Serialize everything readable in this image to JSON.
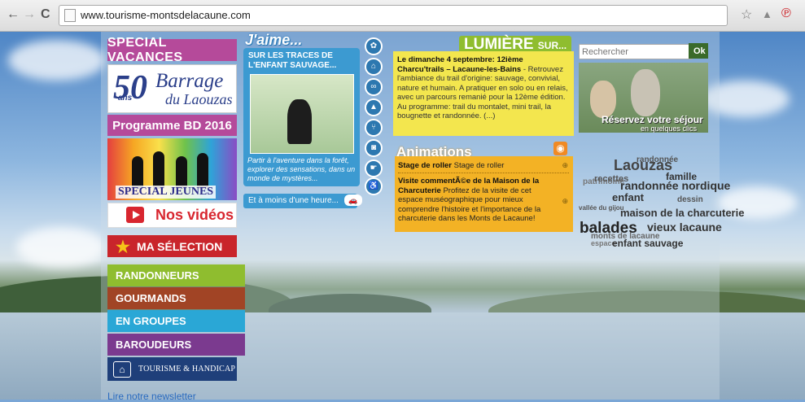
{
  "browser": {
    "url": "www.tourisme-montsdelacaune.com",
    "back_icon": "←",
    "forward_icon": "→",
    "reload_icon": "C",
    "star_icon": "☆",
    "ext_icon": "▲",
    "pin_icon": "℗"
  },
  "left_menu": {
    "special_vacances": "SPECIAL VACANCES",
    "barrage": {
      "num": "50",
      "ans": "ans",
      "line1": "Barrage",
      "line2": "du Laouzas"
    },
    "programme_bd": "Programme BD 2016",
    "special_jeunes": "SPECIAL JEUNES",
    "videos": "Nos vidéos",
    "ma_selection": "MA SÉLECTION",
    "categories": [
      "RANDONNEURS",
      "GOURMANDS",
      "EN GROUPES",
      "BAROUDEURS"
    ],
    "handicap": "TOURISME & HANDICAP",
    "newsletter": "Lire notre newsletter"
  },
  "jaime": {
    "title": "J'aime...",
    "headline": "SUR LES TRACES DE L'ENFANT SAUVAGE...",
    "description": "Partir à l'aventure dans la forêt, explorer des sensations, dans un monde de mystères...",
    "more": "Et à moins d'une heure..."
  },
  "lumiere": {
    "title": "LUMIÈRE",
    "sub": "SUR...",
    "bold": "Le dimanche 4 septembre: 12ième Charcu'trails – Lacaune-les-Bains",
    "text": " - Retrouvez l'ambiance du trail d'origine: sauvage, convivial, nature et humain. A pratiquer en solo ou en relais, avec un parcours remanié pour la 12ème édition. Au programme: trail du montalet, mini trail, la bougnette et randonnée. (...)"
  },
  "animations": {
    "title": "Animations",
    "items": [
      {
        "bold": "Stage de roller",
        "text": " Stage de roller"
      },
      {
        "bold": "Visite commentÃ©e de la Maison de la Charcuterie",
        "text": " Profitez de la visite de cet espace muséographique pour mieux comprendre l'histoire et l'importance de la charcuterie dans les Monts de Lacaune!"
      }
    ]
  },
  "search": {
    "placeholder": "Rechercher",
    "button": "Ok"
  },
  "reserve": {
    "line1": "Réservez votre séjour",
    "line2": "en quelques clics"
  },
  "tag_cloud": [
    "randonnée",
    "Laouzas",
    "famille",
    "patrimoine",
    "recettes",
    "randonnée nordique",
    "enfant",
    "dessin",
    "vallée du gijou",
    "maison de la charcuterie",
    "balades",
    "vieux lacaune",
    "monts de lacaune",
    "espace",
    "enfant sauvage"
  ]
}
